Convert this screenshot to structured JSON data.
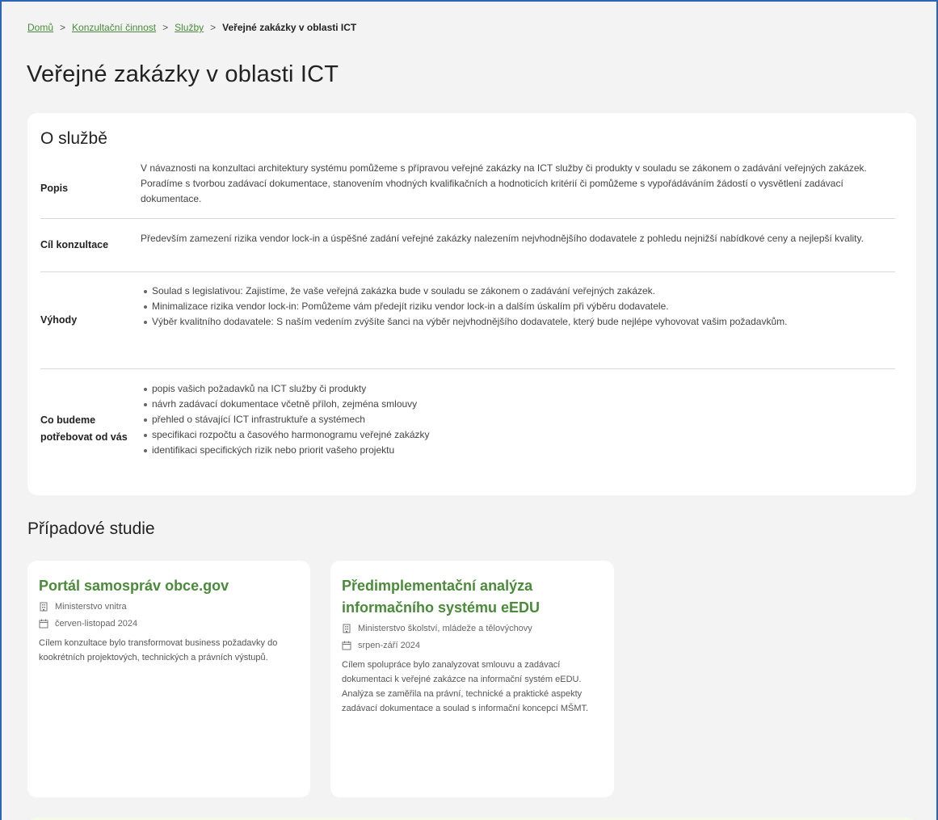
{
  "breadcrumb": {
    "home": "Domů",
    "level1": "Konzultační činnost",
    "level2": "Služby",
    "current": "Veřejné zakázky v oblasti ICT",
    "separator": ">"
  },
  "page_title": "Veřejné zakázky v oblasti ICT",
  "about": {
    "title": "O službě",
    "rows": [
      {
        "label": "Popis",
        "text": "V návaznosti na konzultaci architektury systému pomůžeme s přípravou veřejné zakázky na ICT služby či produkty v souladu se zákonem o zadávání veřejných zakázek. Poradíme s tvorbou zadávací dokumentace, stanovením vhodných kvalifikačních a hodnoticích kritérií či pomůžeme s vypořádáváním žádostí o vysvětlení zadávací dokumentace."
      },
      {
        "label": "Cíl konzultace",
        "text": "Především zamezení rizika vendor lock-in a úspěšné zadání veřejné zakázky nalezením nejvhodnějšího dodavatele z pohledu nejnižší nabídkové ceny a nejlepší kvality."
      },
      {
        "label": "Výhody",
        "items": [
          "Soulad s legislativou: Zajistíme, že vaše veřejná zakázka bude v souladu se zákonem o zadávání veřejných zakázek.",
          "Minimalizace rizika vendor lock-in: Pomůžeme vám předejít riziku vendor lock-in a dalším úskalím při výběru dodavatele.",
          "Výběr kvalitního dodavatele: S naším vedením zvýšíte šanci na výběr nejvhodnějšího dodavatele, který bude nejlépe vyhovovat vašim požadavkům."
        ]
      },
      {
        "label": "Co budeme potřebovat od vás",
        "items": [
          "popis vašich požadavků na ICT služby či produkty",
          "návrh zadávací dokumentace včetně příloh, zejména smlouvy",
          "přehled o stávající ICT infrastruktuře a systémech",
          "specifikaci rozpočtu a časového harmonogramu veřejné zakázky",
          "identifikaci specifických rizik nebo priorit vašeho projektu"
        ]
      }
    ]
  },
  "studies": {
    "title": "Případové studie",
    "items": [
      {
        "title": "Portál samospráv obce.gov",
        "organization": "Ministerstvo vnitra",
        "date": "červen-listopad 2024",
        "text": "Cílem konzultace bylo transformovat business požadavky do kookrétních projektových, technických a právních výstupů."
      },
      {
        "title": "Předimplementační analýza informačního systému eEDU",
        "organization": "Ministerstvo školství, mládeže a tělovýchovy",
        "date": "srpen-září 2024",
        "text": "Cílem spolupráce bylo zanalyzovat smlouvu a zadávací dokumentaci k veřejné zakázce na informační systém eEDU. Analýza se zaměřila na právní, technické a praktické aspekty zadávací dokumentace a soulad s informační koncepcí MŠMT."
      }
    ]
  },
  "colors": {
    "accent_green": "#4a8a3a",
    "frame_blue": "#2e63b5",
    "background": "#f3f3f3",
    "bottom_box": "#f6fbe9"
  }
}
